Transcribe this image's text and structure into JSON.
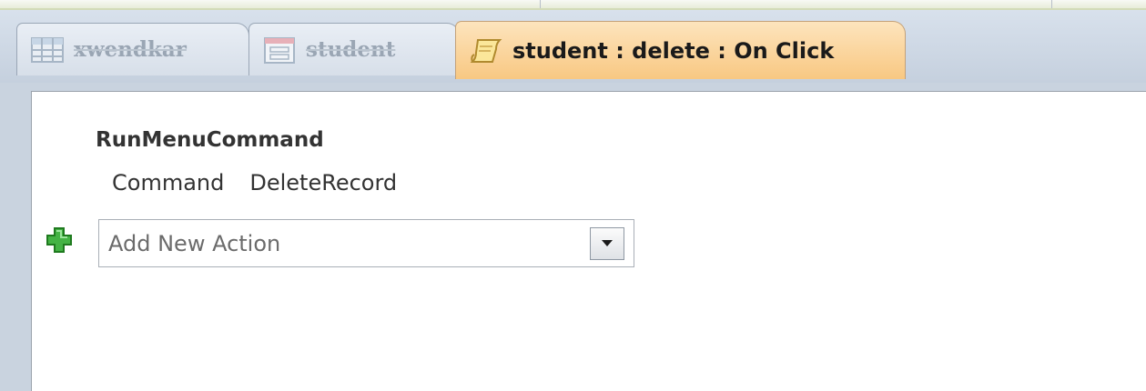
{
  "tabs": [
    {
      "label": "xwendkar",
      "icon": "table-icon",
      "state": "inactive"
    },
    {
      "label": "student",
      "icon": "form-icon",
      "state": "inactive"
    },
    {
      "label": "student : delete : On Click",
      "icon": "macro-icon",
      "state": "active"
    }
  ],
  "macro": {
    "action_name": "RunMenuCommand",
    "argument_label": "Command",
    "argument_value": "DeleteRecord"
  },
  "add_action": {
    "placeholder": "Add New Action",
    "icon": "plus-icon",
    "dropdown_icon": "chevron-down-icon"
  },
  "colors": {
    "active_tab": "#f8c882",
    "plus_icon": "#3cb33c",
    "background": "#c9d3df"
  }
}
